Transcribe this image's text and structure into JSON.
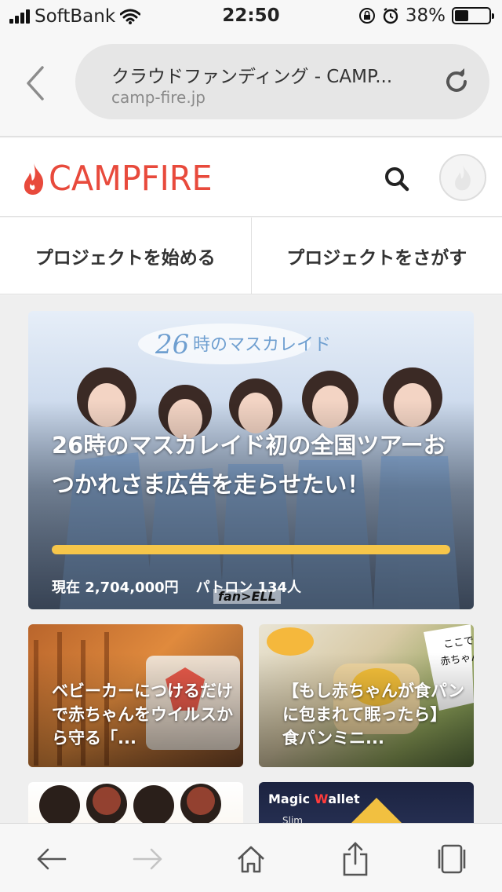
{
  "status_bar": {
    "carrier": "SoftBank",
    "time": "22:50",
    "battery_percent": "38%",
    "battery_level": 0.38
  },
  "browser": {
    "page_title": "クラウドファンディング - CAMP...",
    "domain": "camp-fire.jp"
  },
  "site": {
    "logo_text": "CAMPFIRE",
    "brand_color": "#e84a3c"
  },
  "tabs": [
    {
      "label": "プロジェクトを始める"
    },
    {
      "label": "プロジェクトをさがす"
    }
  ],
  "hero": {
    "title": "26時のマスカレイド初の全国ツアーおつかれさま広告を走らせたい！",
    "progress": 1.0,
    "progress_color": "#f6c64a",
    "raised": "現在 2,704,000円",
    "patrons": "パトロン 134人",
    "image_brand": "fan>ELL"
  },
  "cards": [
    {
      "title": "ベビーカーにつけるだけで赤ちゃんをウイルスから守る「..."
    },
    {
      "title": "【もし赤ちゃんが食パンに包まれて眠ったら】 食パンミニ..."
    },
    {
      "title": ""
    },
    {
      "title": "",
      "image_text_1": "Magic",
      "image_text_2": "W",
      "image_text_3": "allet",
      "image_text_4": "Slim"
    }
  ],
  "icons": {
    "back": "chevron-left-icon",
    "reload": "reload-icon",
    "search": "search-icon",
    "account": "account-icon",
    "toolbar": [
      "back-arrow-icon",
      "forward-arrow-icon",
      "home-icon",
      "share-icon",
      "tabs-icon"
    ]
  }
}
